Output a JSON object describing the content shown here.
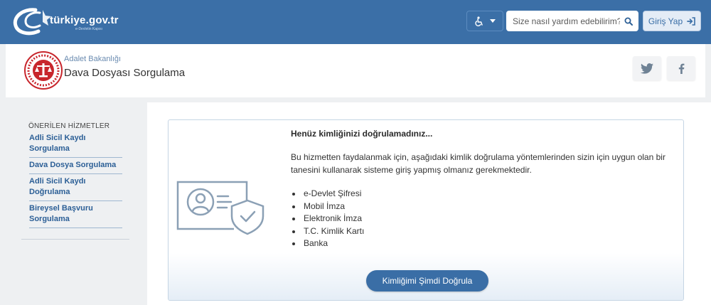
{
  "topbar": {
    "logo_text": "türkiye.gov.tr",
    "logo_tagline": "e-Devletin Kapısı",
    "accessibility_icon": "wheelchair-icon",
    "search_placeholder": "Size nasıl yardım edebilirim?",
    "login_label": "Giriş Yap",
    "colors": {
      "bar": "#3b6fa7"
    }
  },
  "header": {
    "institution": "Adalet Bakanlığı",
    "page_title": "Dava Dosyası Sorgulama",
    "social": [
      "twitter-icon",
      "facebook-icon"
    ]
  },
  "sidebar": {
    "heading": "ÖNERİLEN HİZMETLER",
    "items": [
      {
        "label": "Adli Sicil Kaydı Sorgulama"
      },
      {
        "label": "Dava Dosya Sorgulama"
      },
      {
        "label": "Adli Sicil Kaydı Doğrulama"
      },
      {
        "label": "Bireysel Başvuru Sorgulama"
      }
    ]
  },
  "notice": {
    "title": "Henüz kimliğinizi doğrulamadınız...",
    "text": "Bu hizmetten faydalanmak için, aşağıdaki kimlik doğrulama yöntemlerinden sizin için uygun olan bir tanesini kullanarak sisteme giriş yapmış olmanız gerekmektedir.",
    "methods": [
      "e-Devlet Şifresi",
      "Mobil İmza",
      "Elektronik İmza",
      "T.C. Kimlik Kartı",
      "Banka"
    ],
    "button_label": "Kimliğimi Şimdi Doğrula"
  }
}
